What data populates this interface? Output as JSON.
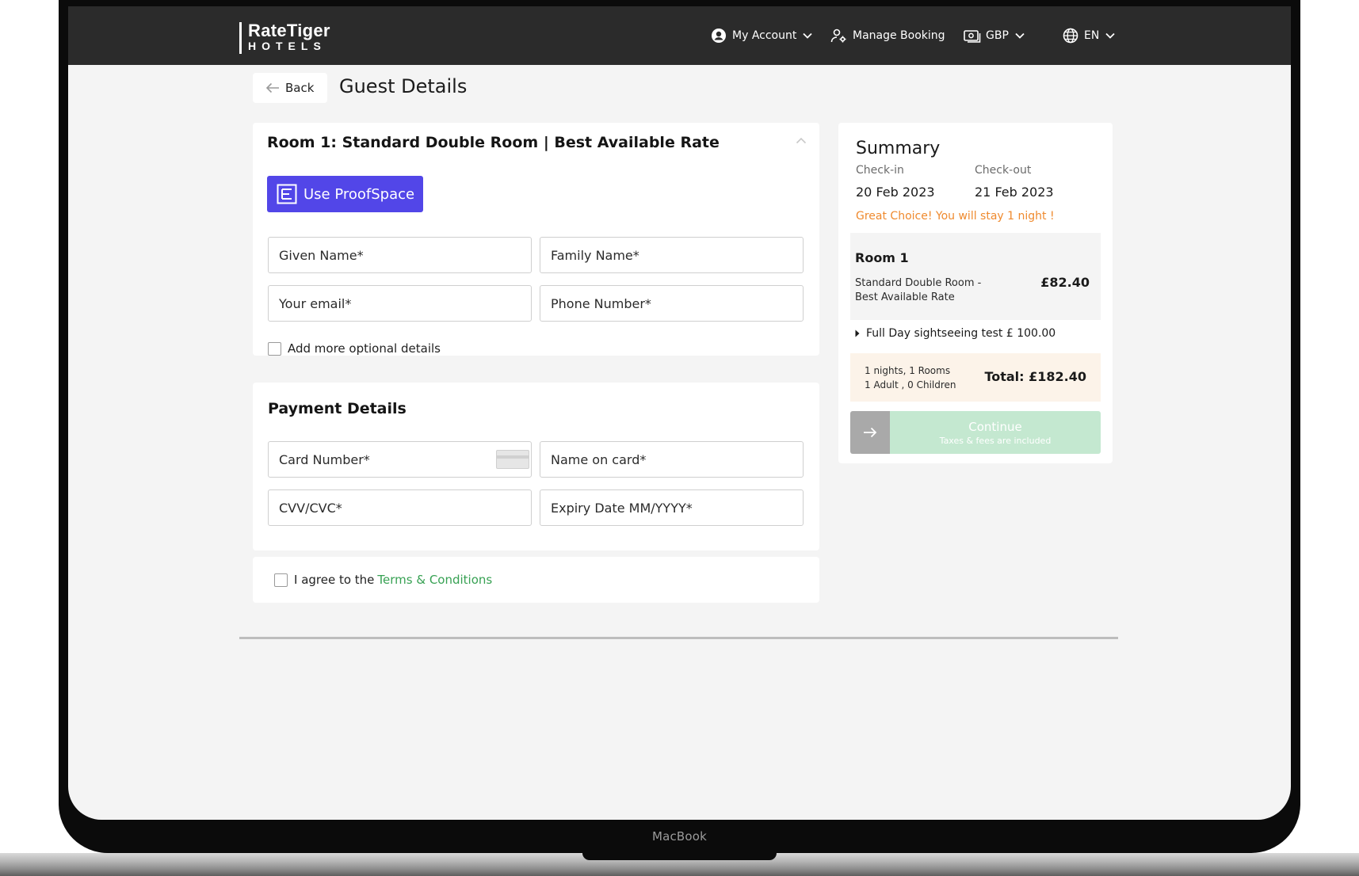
{
  "laptop": {
    "brand": "MacBook"
  },
  "header": {
    "logo_top": "RateTiger",
    "logo_bottom": "HOTELS",
    "account_label": "My Account",
    "manage_booking_label": "Manage Booking",
    "currency_label": "GBP",
    "language_label": "EN"
  },
  "page": {
    "back_label": "Back",
    "title": "Guest Details"
  },
  "guest": {
    "room_title": "Room 1: Standard Double Room | Best Available Rate",
    "proofspace_label": "Use ProofSpace",
    "given_name_placeholder": "Given Name*",
    "family_name_placeholder": "Family Name*",
    "email_placeholder": "Your email*",
    "phone_placeholder": "Phone Number*",
    "optional_details_label": "Add more optional details"
  },
  "payment": {
    "title": "Payment Details",
    "card_number_placeholder": "Card Number*",
    "name_on_card_placeholder": "Name on card*",
    "cvv_placeholder": "CVV/CVC*",
    "expiry_placeholder": "Expiry Date MM/YYYY*"
  },
  "terms": {
    "prefix": "I agree to the",
    "link": "Terms & Conditions"
  },
  "summary": {
    "title": "Summary",
    "checkin_label": "Check-in",
    "checkout_label": "Check-out",
    "checkin_date": "20 Feb 2023",
    "checkout_date": "21 Feb 2023",
    "note": "Great Choice! You will stay 1 night !",
    "room_label": "Room 1",
    "room_desc": "Standard Double Room - Best Available Rate",
    "room_price": "£82.40",
    "extra": "Full Day sightseeing test £ 100.00",
    "stay_line1": "1 nights, 1 Rooms",
    "stay_line2": "1 Adult , 0 Children",
    "total": "Total: £182.40",
    "continue_label": "Continue",
    "continue_sub": "Taxes & fees are included"
  },
  "colors": {
    "header_bg": "#2b2b2b",
    "proofspace": "#5246e8",
    "note_orange": "#ef8a2e",
    "link_green": "#37a153",
    "continue_green": "#c4e8d0"
  }
}
